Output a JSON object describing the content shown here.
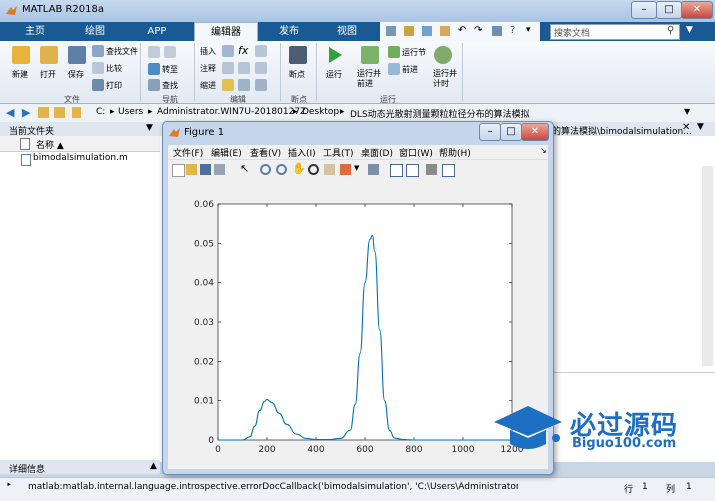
{
  "window": {
    "title": "MATLAB R2018a",
    "search_placeholder": "搜索文档"
  },
  "ribbon_tabs": [
    "主页",
    "绘图",
    "APP",
    "编辑器",
    "发布",
    "视图"
  ],
  "ribbon": {
    "new": "新建",
    "open": "打开",
    "save": "保存",
    "find_files": "查找文件",
    "compare": "比较",
    "print": "打印",
    "goto": "转至",
    "find": "查找",
    "insert": "插入",
    "comment": "注释",
    "indent": "缩进",
    "fx": "fx",
    "breakpoints": "断点",
    "run": "运行",
    "run_advance": "运行并\n前进",
    "run_section": "运行节",
    "advance": "前进",
    "run_time": "运行并\n计时",
    "sections": [
      "文件",
      "导航",
      "编辑",
      "断点",
      "运行"
    ]
  },
  "address": {
    "crumbs": [
      "C:",
      "Users",
      "Administrator.WIN7U-20180127Z",
      "Desktop",
      "DLS动态光散射测量颗粒粒径分布的算法模拟"
    ],
    "right_title": "的算法模拟\\bimodalsimulation..."
  },
  "current_folder": {
    "header": "当前文件夹",
    "column": "名称 ▲",
    "files": [
      "bimodalsimulation.m"
    ]
  },
  "details_header": "详细信息",
  "status": {
    "message": "matlab:matlab.internal.language.introspective.errorDocCallback('bimodalsimulation', 'C:\\Users\\Administrator.WIN7U-...",
    "row_label": "行",
    "row": "1",
    "col_label": "列",
    "col": "1"
  },
  "figure": {
    "title": "Figure 1",
    "menu": [
      "文件(F)",
      "编辑(E)",
      "查看(V)",
      "插入(I)",
      "工具(T)",
      "桌面(D)",
      "窗口(W)",
      "帮助(H)"
    ]
  },
  "watermark": {
    "text": "必过源码",
    "sub": "Biguo100.com"
  },
  "chart_data": {
    "type": "line",
    "title": "",
    "xlabel": "",
    "ylabel": "",
    "xlim": [
      0,
      1200
    ],
    "ylim": [
      0,
      0.06
    ],
    "xticks": [
      0,
      200,
      400,
      600,
      800,
      1000,
      1200
    ],
    "yticks": [
      0,
      0.01,
      0.02,
      0.03,
      0.04,
      0.05,
      0.06
    ],
    "ytick_labels": [
      "0",
      "0.01",
      "0.02",
      "0.03",
      "0.04",
      "0.05",
      "0.06"
    ],
    "color": "#0072bd",
    "series": [
      {
        "x": [
          0,
          100,
          130,
          150,
          170,
          190,
          200,
          220,
          250,
          280,
          320,
          360,
          400,
          450,
          500,
          540,
          560,
          580,
          600,
          620,
          630,
          640,
          660,
          680,
          700,
          720,
          760,
          800,
          1000,
          1200
        ],
        "values": [
          0,
          0,
          0.0008,
          0.0035,
          0.0075,
          0.0098,
          0.0103,
          0.0095,
          0.0068,
          0.004,
          0.0015,
          0.0004,
          0.0001,
          0.0001,
          0.0004,
          0.0025,
          0.009,
          0.022,
          0.04,
          0.051,
          0.052,
          0.048,
          0.028,
          0.01,
          0.0025,
          0.0005,
          0.0001,
          0,
          0,
          0
        ]
      }
    ]
  }
}
